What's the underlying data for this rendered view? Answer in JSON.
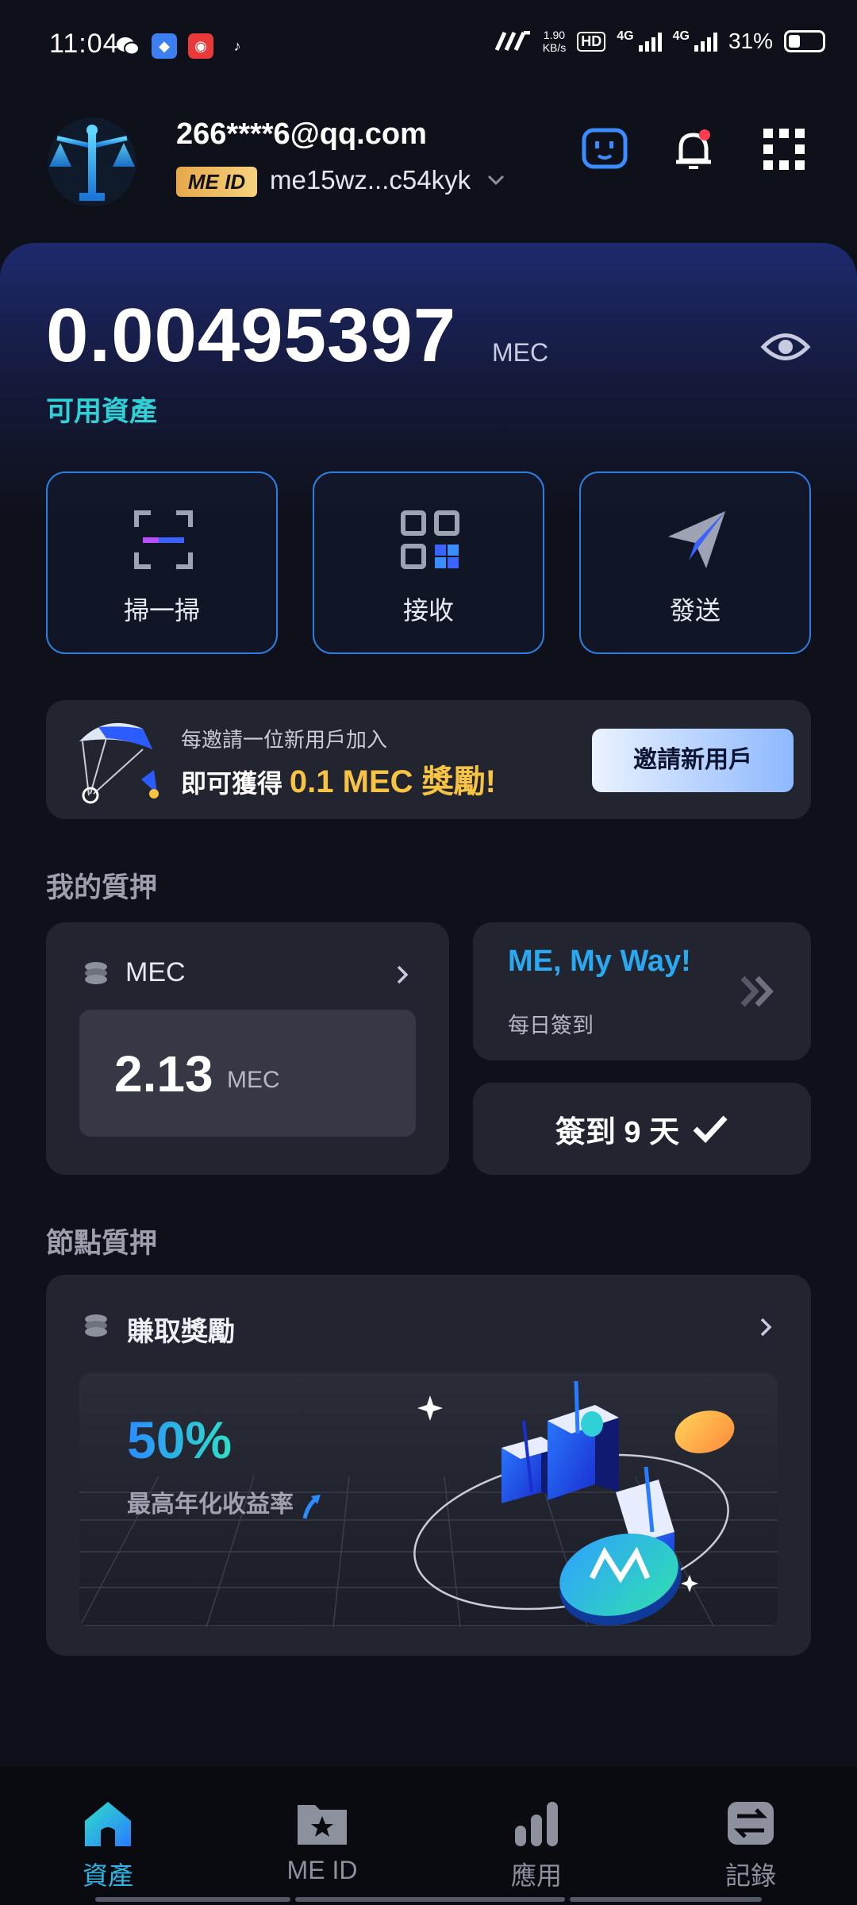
{
  "status_bar": {
    "time": "11:04",
    "net_speed_value": "1.90",
    "net_speed_unit": "KB/s",
    "hd_label": "HD",
    "net_type_1": "4G",
    "net_type_2": "4G",
    "battery_text": "31%"
  },
  "header": {
    "email": "266****6@qq.com",
    "meid_badge": "ME ID",
    "meid_address": "me15wz...c54kyk"
  },
  "balance": {
    "amount": "0.00495397",
    "unit": "MEC",
    "label": "可用資產"
  },
  "actions": [
    {
      "label": "掃一掃"
    },
    {
      "label": "接收"
    },
    {
      "label": "發送"
    }
  ],
  "invite": {
    "line1": "每邀請一位新用戶加入",
    "line2_prefix": "即可獲得",
    "line2_highlight": "0.1 MEC 獎勵!",
    "button": "邀請新用戶"
  },
  "my_staking": {
    "title": "我的質押",
    "token": "MEC",
    "value": "2.13",
    "unit": "MEC"
  },
  "checkin": {
    "title": "ME, My Way!",
    "subtitle": "每日簽到",
    "button": "簽到 9 天"
  },
  "node_staking": {
    "section_title": "節點質押",
    "card_title": "賺取獎勵",
    "percent": "50%",
    "subtitle": "最高年化收益率"
  },
  "nav": [
    {
      "label": "資產",
      "active": true
    },
    {
      "label": "ME ID",
      "active": false
    },
    {
      "label": "應用",
      "active": false
    },
    {
      "label": "記錄",
      "active": false
    }
  ],
  "colors": {
    "accent_teal": "#2fd0d6",
    "accent_blue": "#2f7de0",
    "highlight_yellow": "#f7c342",
    "background": "#0f111a",
    "card": "#22242f"
  }
}
